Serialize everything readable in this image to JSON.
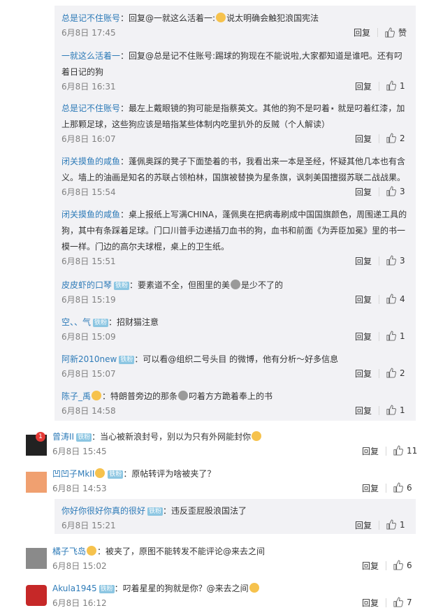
{
  "comments": [
    {
      "name": "总是记不住账号",
      "text": "：回复@一就这么活着一:",
      "text2": "说太明确会触犯浪国宪法",
      "time": "6月8日 17:45",
      "reply": "回复",
      "likes": "赞"
    },
    {
      "name": "一就这么活着一",
      "text": "：回复@总是记不住账号:踢球的狗现在不能说啦,大家都知道是谁吧。还有叼着日记的狗",
      "time": "6月8日 16:31",
      "reply": "回复",
      "likes": "1"
    },
    {
      "name": "总是记不住账号",
      "text": "：最左上戴眼镜的狗可能是指蔡英文。其他的狗不是叼着⋆ 就是叼着红漆，加上那颗足球，这些狗应该是暗指某些体制内吃里扒外的反贼（个人解读）",
      "time": "6月8日 16:07",
      "reply": "回复",
      "likes": "2"
    },
    {
      "name": "闭关摸鱼的咸鱼",
      "text": "：蓬佩奥踩的凳子下面垫着的书，我看出来一本是圣经，怀疑其他几本也有含义。墙上的油画是知名的苏联占领柏林，国旗被替换为星条旗，讽刺美国擅掇苏联二战战果。",
      "time": "6月8日 15:54",
      "reply": "回复",
      "likes": "3"
    },
    {
      "name": "闭关摸鱼的咸鱼",
      "text": "：桌上报纸上写满CHINA，蓬佩奥在把病毒刷成中国国旗颜色，周围递工具的狗，其中有条踩着足球。门口川普手边递插刀血书的狗，血书和前面《为弄臣加冕》里的书一模一样。门边的高尔夫球棍，桌上的卫生纸。",
      "time": "6月8日 15:51",
      "reply": "回复",
      "likes": "3"
    },
    {
      "name": "皮皮虾的口琴",
      "badge": "铁粉",
      "text": "：要素道不全，但图里的美",
      "text2": "是少不了的",
      "time": "6月8日 15:19",
      "reply": "回复",
      "likes": "4"
    },
    {
      "name": "空、、气",
      "badge": "铁粉",
      "text": "：招财猫注意",
      "time": "6月8日 15:09",
      "reply": "回复",
      "likes": "1"
    },
    {
      "name": "阿新2010new",
      "badge": "铁粉",
      "text": "：可以看@组织二号头目 的微博，他有分析～好多信息",
      "time": "6月8日 15:07",
      "reply": "回复",
      "likes": "2"
    },
    {
      "name": "陈子_禹",
      "text": "：特朗普旁边的那条",
      "text2": "叼着方方跪着奉上的书",
      "time": "6月8日 14:58",
      "reply": "回复",
      "likes": "1"
    }
  ],
  "main": [
    {
      "name": "曾涛II",
      "badge": "铁粉",
      "text": "：当心被新浪封号，别以为只有外网能封你",
      "time": "6月8日 15:45",
      "reply": "回复",
      "likes": "11",
      "notif": "1"
    },
    {
      "name": "凹凹子MkII",
      "badge": "铁粉",
      "text": "：原帖转评为啥被夹了？",
      "time": "6月8日 14:53",
      "reply": "回复",
      "likes": "6"
    },
    {
      "name": "橘子飞岛",
      "text": "：被夹了，原图不能转发不能评论@来去之间",
      "time": "6月8日 15:02",
      "reply": "回复",
      "likes": "6"
    },
    {
      "name": "Akula1945",
      "badge": "铁粉",
      "text": "：叼着星星的狗就是你？@来去之间",
      "time": "6月8日 16:12",
      "reply": "回复",
      "likes": "7"
    }
  ],
  "reply": {
    "name": "你好你很好你真的很好",
    "badge": "铁粉",
    "text": "：违反歪屁股浪国法了",
    "time": "6月8日 15:21",
    "reply": "回复",
    "likes": "1"
  }
}
